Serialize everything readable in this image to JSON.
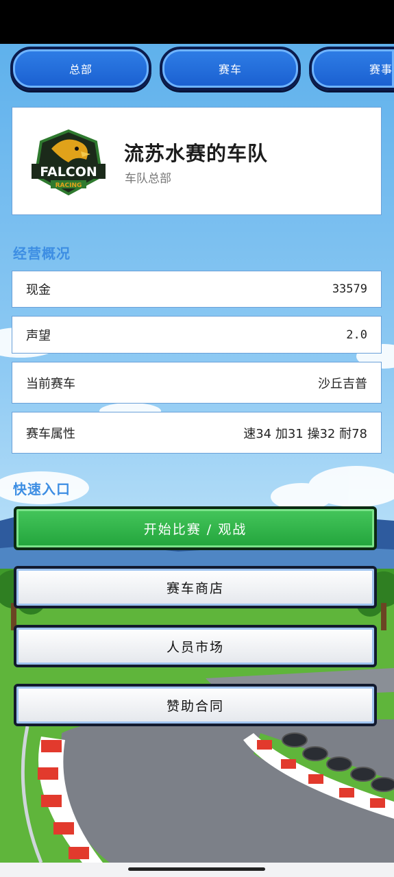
{
  "tabs": [
    {
      "label": "总部"
    },
    {
      "label": "赛车"
    },
    {
      "label": "赛事"
    }
  ],
  "team": {
    "logo_text": "FALCON",
    "logo_subtext": "RACING",
    "name": "流苏水赛的车队",
    "subtitle": "车队总部"
  },
  "overview": {
    "title": "经营概况",
    "rows": [
      {
        "label": "现金",
        "value": "33579"
      },
      {
        "label": "声望",
        "value": "2.0"
      },
      {
        "label": "当前赛车",
        "value": "沙丘吉普"
      },
      {
        "label": "赛车属性",
        "value": "速34 加31 操32 耐78"
      }
    ]
  },
  "quick": {
    "title": "快速入口",
    "buttons": [
      {
        "label": "开始比赛 / 观战"
      },
      {
        "label": "赛车商店"
      },
      {
        "label": "人员市场"
      },
      {
        "label": "赞助合同"
      }
    ]
  },
  "colors": {
    "tab_blue": "#1f68d8",
    "section_title": "#3d8ee3",
    "green_button": "#2fb64a"
  }
}
